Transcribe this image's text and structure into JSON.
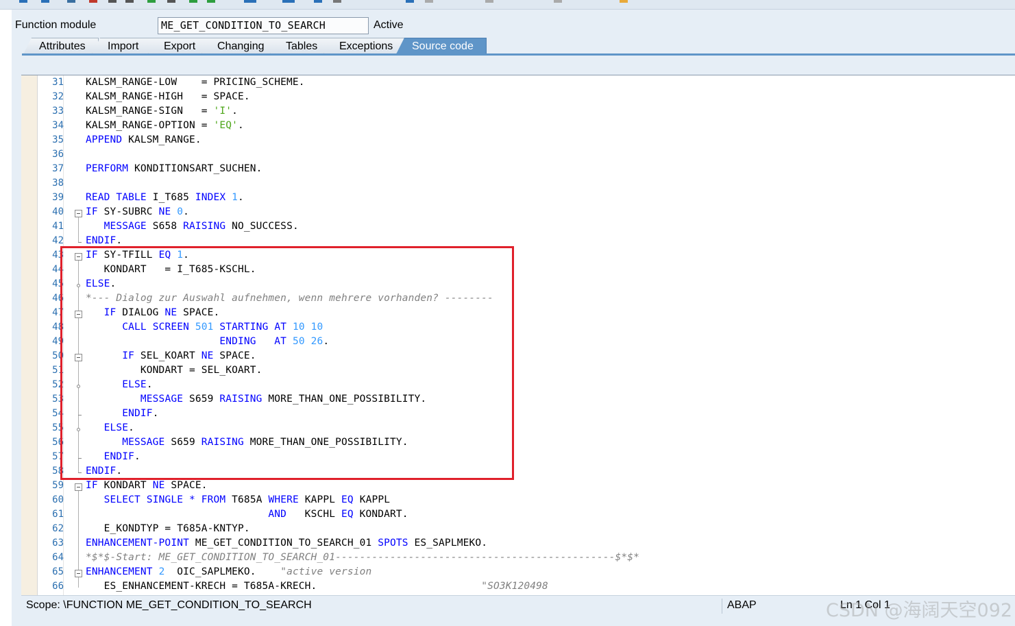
{
  "header": {
    "function_module_label": "Function module",
    "function_module_value": "ME_GET_CONDITION_TO_SEARCH",
    "status": "Active"
  },
  "tabs": [
    {
      "label": "Attributes",
      "active": false
    },
    {
      "label": "Import",
      "active": false
    },
    {
      "label": "Export",
      "active": false
    },
    {
      "label": "Changing",
      "active": false
    },
    {
      "label": "Tables",
      "active": false
    },
    {
      "label": "Exceptions",
      "active": false
    },
    {
      "label": "Source code",
      "active": true
    }
  ],
  "code_lines": [
    {
      "n": "31",
      "text": "KALSM_RANGE-LOW    = PRICING_SCHEME."
    },
    {
      "n": "32",
      "text": "KALSM_RANGE-HIGH   = SPACE."
    },
    {
      "n": "33",
      "text": "KALSM_RANGE-SIGN   = 'I'."
    },
    {
      "n": "34",
      "text": "KALSM_RANGE-OPTION = 'EQ'."
    },
    {
      "n": "35",
      "text": "APPEND KALSM_RANGE."
    },
    {
      "n": "36",
      "text": ""
    },
    {
      "n": "37",
      "text": "PERFORM KONDITIONSART_SUCHEN."
    },
    {
      "n": "38",
      "text": ""
    },
    {
      "n": "39",
      "text": "READ TABLE I_T685 INDEX 1."
    },
    {
      "n": "40",
      "text": "IF SY-SUBRC NE 0."
    },
    {
      "n": "41",
      "text": "   MESSAGE S658 RAISING NO_SUCCESS."
    },
    {
      "n": "42",
      "text": "ENDIF."
    },
    {
      "n": "43",
      "text": "IF SY-TFILL EQ 1."
    },
    {
      "n": "44",
      "text": "   KONDART   = I_T685-KSCHL."
    },
    {
      "n": "45",
      "text": "ELSE."
    },
    {
      "n": "46",
      "text": "*--- Dialog zur Auswahl aufnehmen, wenn mehrere vorhanden? --------"
    },
    {
      "n": "47",
      "text": "   IF DIALOG NE SPACE."
    },
    {
      "n": "48",
      "text": "      CALL SCREEN 501 STARTING AT 10 10"
    },
    {
      "n": "49",
      "text": "                      ENDING   AT 50 26."
    },
    {
      "n": "50",
      "text": "      IF SEL_KOART NE SPACE."
    },
    {
      "n": "51",
      "text": "         KONDART = SEL_KOART."
    },
    {
      "n": "52",
      "text": "      ELSE."
    },
    {
      "n": "53",
      "text": "         MESSAGE S659 RAISING MORE_THAN_ONE_POSSIBILITY."
    },
    {
      "n": "54",
      "text": "      ENDIF."
    },
    {
      "n": "55",
      "text": "   ELSE."
    },
    {
      "n": "56",
      "text": "      MESSAGE S659 RAISING MORE_THAN_ONE_POSSIBILITY."
    },
    {
      "n": "57",
      "text": "   ENDIF."
    },
    {
      "n": "58",
      "text": "ENDIF."
    },
    {
      "n": "59",
      "text": "IF KONDART NE SPACE."
    },
    {
      "n": "60",
      "text": "   SELECT SINGLE * FROM T685A WHERE KAPPL EQ KAPPL"
    },
    {
      "n": "61",
      "text": "                              AND   KSCHL EQ KONDART."
    },
    {
      "n": "62",
      "text": "   E_KONDTYP = T685A-KNTYP."
    },
    {
      "n": "63",
      "text": "ENHANCEMENT-POINT ME_GET_CONDITION_TO_SEARCH_01 SPOTS ES_SAPLMEKO."
    },
    {
      "n": "64",
      "text": "*$*$-Start: ME_GET_CONDITION_TO_SEARCH_01----------------------------------------------$*$*"
    },
    {
      "n": "65",
      "text": "ENHANCEMENT 2  OIC_SAPLMEKO.    \"active version"
    },
    {
      "n": "66",
      "text": "   ES_ENHANCEMENT-KRECH = T685A-KRECH.                           \"SO3K120498"
    }
  ],
  "status_bar": {
    "scope": "Scope: \\FUNCTION ME_GET_CONDITION_TO_SEARCH",
    "language": "ABAP",
    "position": "Ln   1 Col   1"
  },
  "watermark": "CSDN @海阔天空092",
  "colors": {
    "keyword": "#0000ff",
    "number": "#3399ff",
    "string": "#4da619",
    "comment": "#808080",
    "highlight_box": "#e0202b",
    "active_tab": "#5f95c8"
  }
}
